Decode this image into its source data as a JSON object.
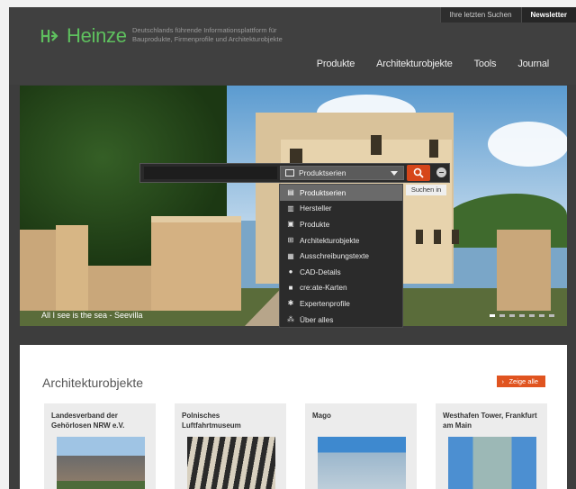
{
  "header": {
    "logo_text": "Heinze",
    "tagline": "Deutschlands führende Informationsplattform für Bauprodukte, Firmenprofile und Architekturobjekte",
    "top_buttons": [
      "Ihre letzten Suchen",
      "Newsletter"
    ],
    "nav": [
      "Produkte",
      "Architekturobjekte",
      "Tools",
      "Journal"
    ]
  },
  "hero": {
    "caption": "All I see is the sea - Seevilla",
    "slides": 7,
    "active_slide": 1
  },
  "search": {
    "selected": "Produktserien",
    "tooltip": "Suchen in",
    "options": [
      {
        "label": "Produktserien",
        "icon": "series-icon"
      },
      {
        "label": "Hersteller",
        "icon": "manufacturer-icon"
      },
      {
        "label": "Produkte",
        "icon": "product-icon"
      },
      {
        "label": "Architekturobjekte",
        "icon": "building-icon"
      },
      {
        "label": "Ausschreibungstexte",
        "icon": "document-icon"
      },
      {
        "label": "CAD-Details",
        "icon": "cad-icon"
      },
      {
        "label": "cre:ate-Karten",
        "icon": "card-icon"
      },
      {
        "label": "Expertenprofile",
        "icon": "people-icon"
      },
      {
        "label": "Über alles",
        "icon": "all-icon"
      }
    ]
  },
  "section": {
    "title": "Architekturobjekte",
    "more": "Zeige alle",
    "cards": [
      {
        "title": "Landesverband der Gehörlosen NRW e.V."
      },
      {
        "title": "Polnisches Luftfahrtmuseum"
      },
      {
        "title": "Mago"
      },
      {
        "title": "Westhafen Tower, Frankfurt am Main"
      }
    ]
  },
  "colors": {
    "accent": "#d6461a",
    "brand_green": "#5ec05e",
    "dark": "#3d3d3d"
  }
}
